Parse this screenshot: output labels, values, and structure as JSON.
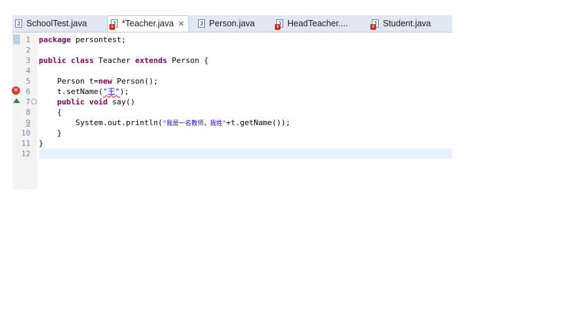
{
  "tabs": [
    {
      "label": "SchoolTest.java",
      "error": false,
      "active": false,
      "closable": false
    },
    {
      "label": "*Teacher.java",
      "error": true,
      "active": true,
      "closable": true
    },
    {
      "label": "Person.java",
      "error": false,
      "active": false,
      "closable": false
    },
    {
      "label": "HeadTeacher....",
      "error": true,
      "active": false,
      "closable": false
    },
    {
      "label": "Student.java",
      "error": true,
      "active": false,
      "closable": false
    }
  ],
  "icons": {
    "java_file": "java-file-icon",
    "error_overlay": "error-overlay-icon",
    "close": "close-icon",
    "error_marker": "error-marker-icon",
    "override_marker": "override-arrow-icon",
    "fold": "fold-toggle-icon"
  },
  "line_numbers": [
    "1",
    "2",
    "3",
    "4",
    "5",
    "6",
    "7",
    "8",
    "9",
    "10",
    "11",
    "12"
  ],
  "code": {
    "l1_kw": "package",
    "l1_rest": " persontest;",
    "l3_kw1": "public",
    "l3_kw2": "class",
    "l3_mid": " Teacher ",
    "l3_kw3": "extends",
    "l3_rest": " Person {",
    "l5_a": "    Person t=",
    "l5_kw": "new",
    "l5_b": " Person();",
    "l6_a": "    t",
    "l6_b": ".setName(",
    "l6_str": "\"王\"",
    "l6_c": ");",
    "l7_indent": "    ",
    "l7_kw1": "public",
    "l7_kw2": "void",
    "l7_rest": " say()",
    "l8": "    {",
    "l9_a": "        System.out.println(",
    "l9_str": "\"我是一名教师，我姓\"",
    "l9_b": "+t.getName());",
    "l10": "    }",
    "l11": "}"
  },
  "colors": {
    "keyword": "#7f0055",
    "string": "#2a00ff",
    "current_line": "#e8f2fe",
    "tab_bar": "#dfe8f3"
  }
}
